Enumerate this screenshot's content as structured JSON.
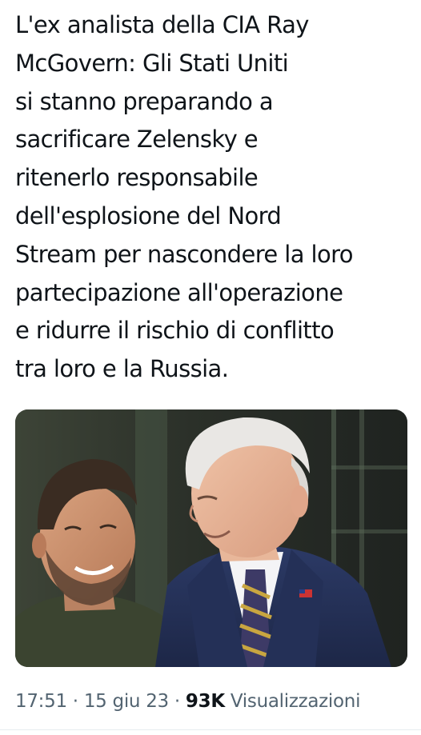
{
  "tweet": {
    "text": "L'ex analista della CIA Ray\nMcGovern: Gli Stati Uniti\nsi stanno preparando a\nsacrificare Zelensky e\nritenerlo responsabile\ndell'esplosione del Nord\nStream per nascondere la loro\npartecipazione all'operazione\ne ridurre il rischio di conflitto\ntra loro e la Russia.",
    "media": {
      "kind": "photo"
    },
    "meta": {
      "time": "17:51",
      "sep1": " · ",
      "date": "15 giu 23",
      "sep2": " · ",
      "views_count": "93K",
      "views_label": " Visualizzazioni"
    }
  },
  "colors": {
    "text": "#0f1419",
    "secondary": "#536471",
    "background": "#ffffff"
  }
}
